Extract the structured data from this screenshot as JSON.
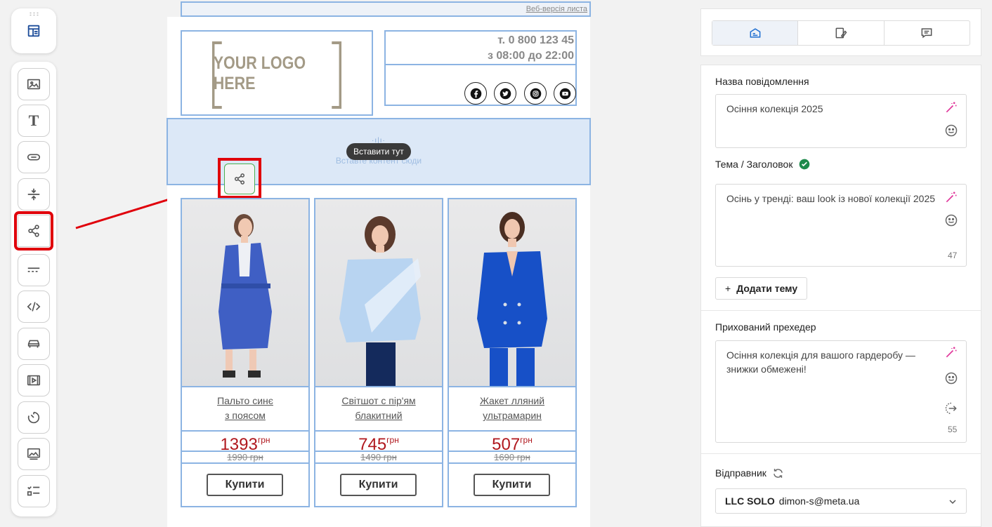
{
  "email": {
    "web_version": "Веб-версія листа",
    "logo_text": "YOUR LOGO HERE",
    "phone": "т. 0 800 123 45",
    "hours": "з 08:00 до 22:00",
    "insert_hint": "Вставте контент сюди",
    "insert_tooltip": "Вставити тут",
    "products": [
      {
        "title1": "Пальто синє",
        "title2": "з поясом",
        "price": "1393",
        "currency": "грн",
        "old_price": "1990 грн",
        "buy": "Купити"
      },
      {
        "title1": "Світшот с пір'ям",
        "title2": "блакитний",
        "price": "745",
        "currency": "грн",
        "old_price": "1490 грн",
        "buy": "Купити"
      },
      {
        "title1": "Жакет лляний",
        "title2": "ультрамарин",
        "price": "507",
        "currency": "грн",
        "old_price": "1690 грн",
        "buy": "Купити"
      }
    ]
  },
  "toolbar": {
    "icons": [
      "image-block-icon",
      "text-block-icon",
      "button-block-icon",
      "spacer-block-icon",
      "social-block-icon",
      "divider-block-icon",
      "html-code-icon",
      "car-block-icon",
      "video-block-icon",
      "timer-block-icon",
      "banner-block-icon",
      "list-block-icon"
    ]
  },
  "settings": {
    "message_name_label": "Назва повідомлення",
    "message_name_value": "Осіння колекція 2025",
    "subject_label": "Тема / Заголовок",
    "subject_value": "Осінь у тренді: ваш look із нової колекції 2025",
    "subject_count": "47",
    "add_topic": "Додати тему",
    "add_topic_plus": "+",
    "preheader_label": "Прихований прехедер",
    "preheader_value": "Осіння колекція для вашого гардеробу — знижки обмежені!",
    "preheader_count": "55",
    "sender_label": "Відправник",
    "sender_company": "LLC SOLO",
    "sender_email": "dimon-s@meta.ua"
  },
  "colors": {
    "accent_blue": "#1f6fd1",
    "selection_blue": "#8cb4e3",
    "price_red": "#b0181e",
    "highlight_red": "#e0000b",
    "wand_pink": "#e0359a"
  }
}
